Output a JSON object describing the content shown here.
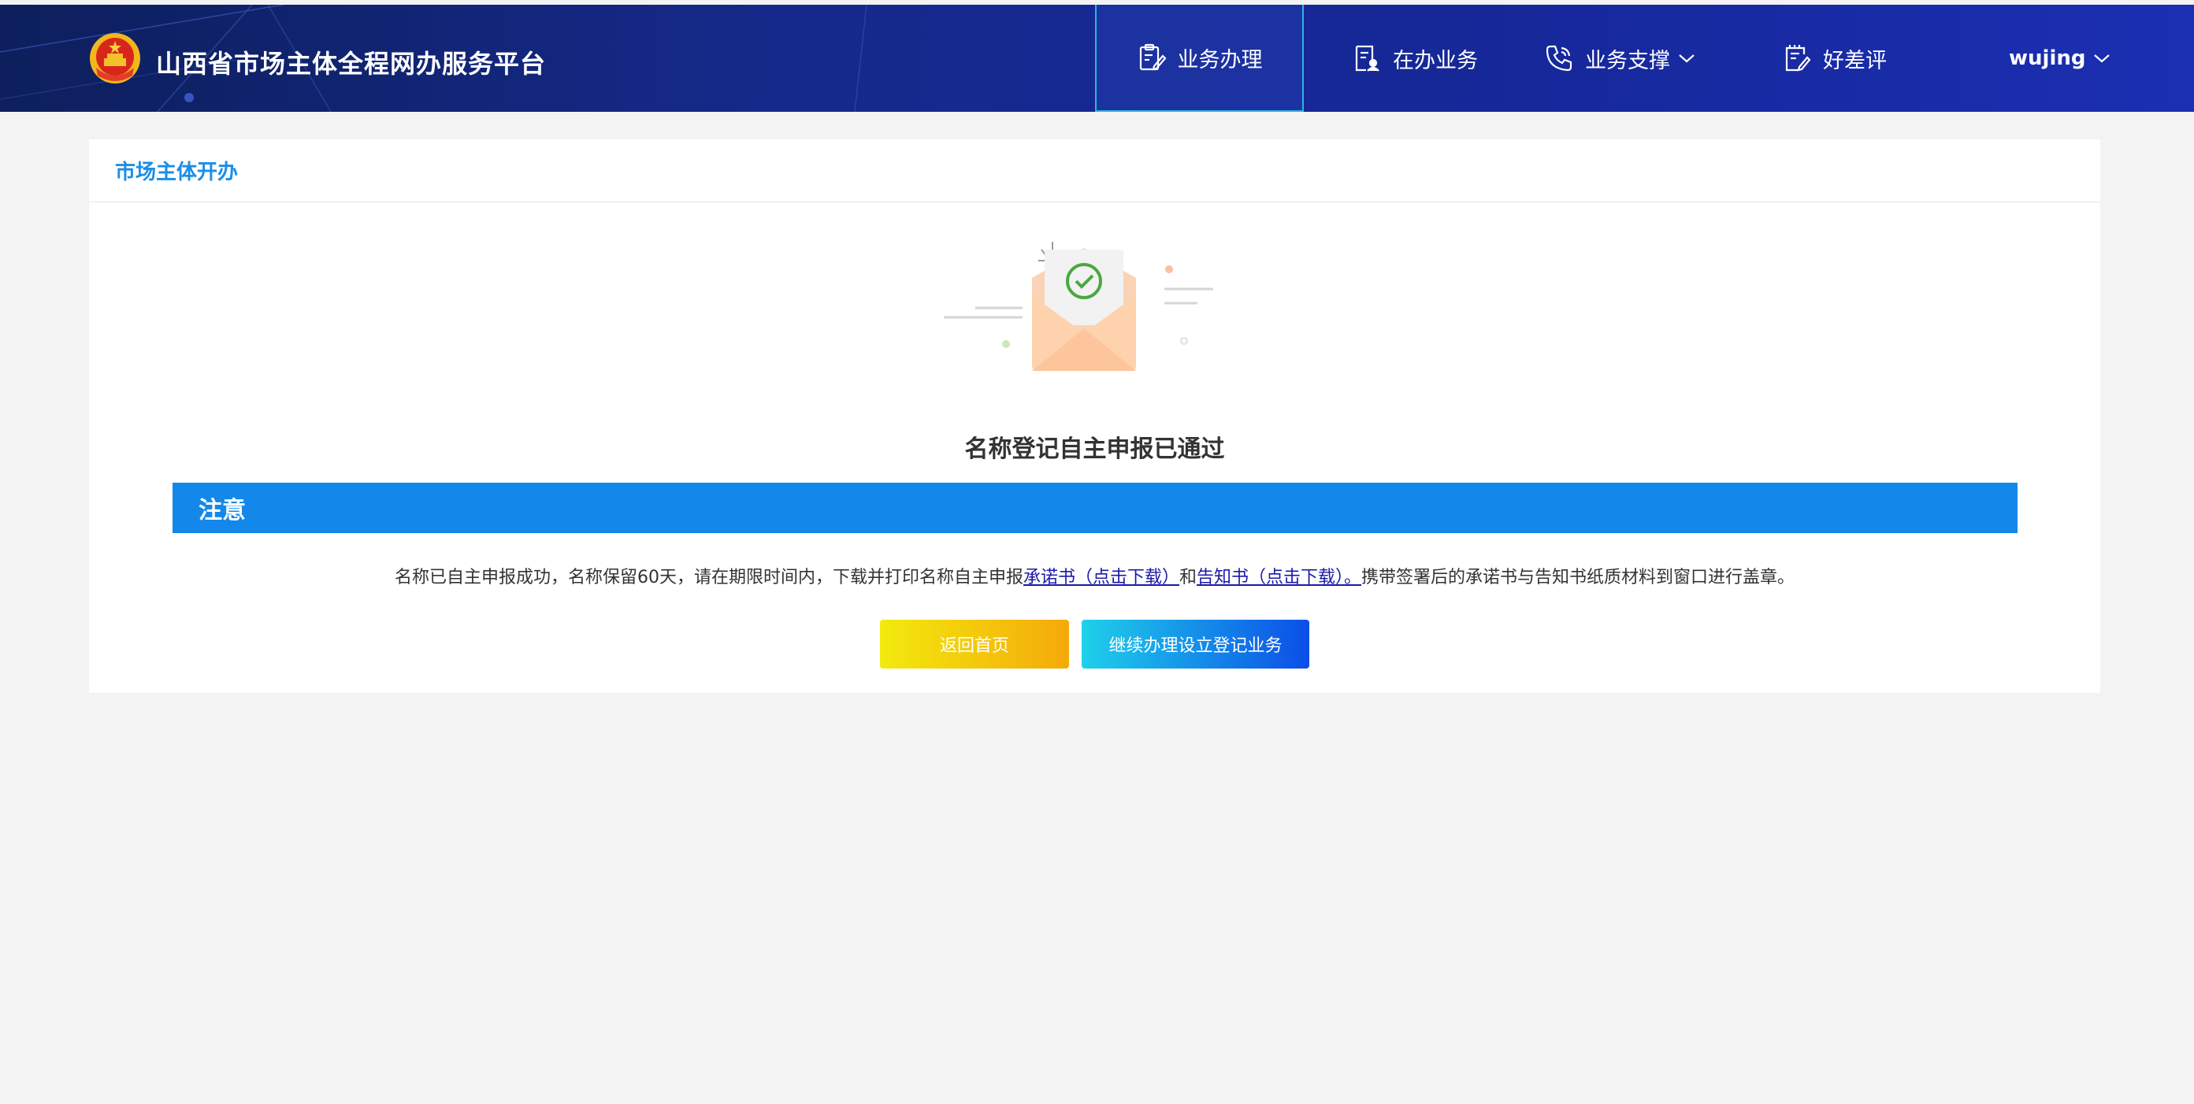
{
  "header": {
    "site_title": "山西省市场主体全程网办服务平台",
    "nav": {
      "business": "业务办理",
      "ongoing": "在办业务",
      "support": "业务支撑",
      "review": "好差评",
      "user": "wujing"
    },
    "icons": {
      "logo": "national-emblem-icon",
      "business": "clipboard-edit-icon",
      "ongoing": "document-user-icon",
      "support": "phone-icon",
      "review": "document-edit-icon",
      "dropdown": "chevron-down-icon"
    },
    "colors": {
      "gradient_start": "#0d1f5c",
      "gradient_end": "#1b2fb3",
      "active_border": "#2bb5d8"
    }
  },
  "card": {
    "heading": "市场主体开办",
    "result_title": "名称登记自主申报已通过",
    "notice_title": "注意",
    "notice": {
      "prefix": "名称已自主申报成功，名称保留60天，请在期限时间内，下载并打印名称自主申报",
      "link1": "承诺书（点击下载）",
      "joiner": "和",
      "link2": "告知书（点击下载）。",
      "suffix": "携带签署后的承诺书与告知书纸质材料到窗口进行盖章。"
    },
    "buttons": {
      "home": "返回首页",
      "continue": "继续办理设立登记业务"
    },
    "illustration_icon": "envelope-success-icon",
    "colors": {
      "accent": "#1a8ee8",
      "notice_bar": "#1388ea",
      "link": "#1a1aa8"
    }
  }
}
